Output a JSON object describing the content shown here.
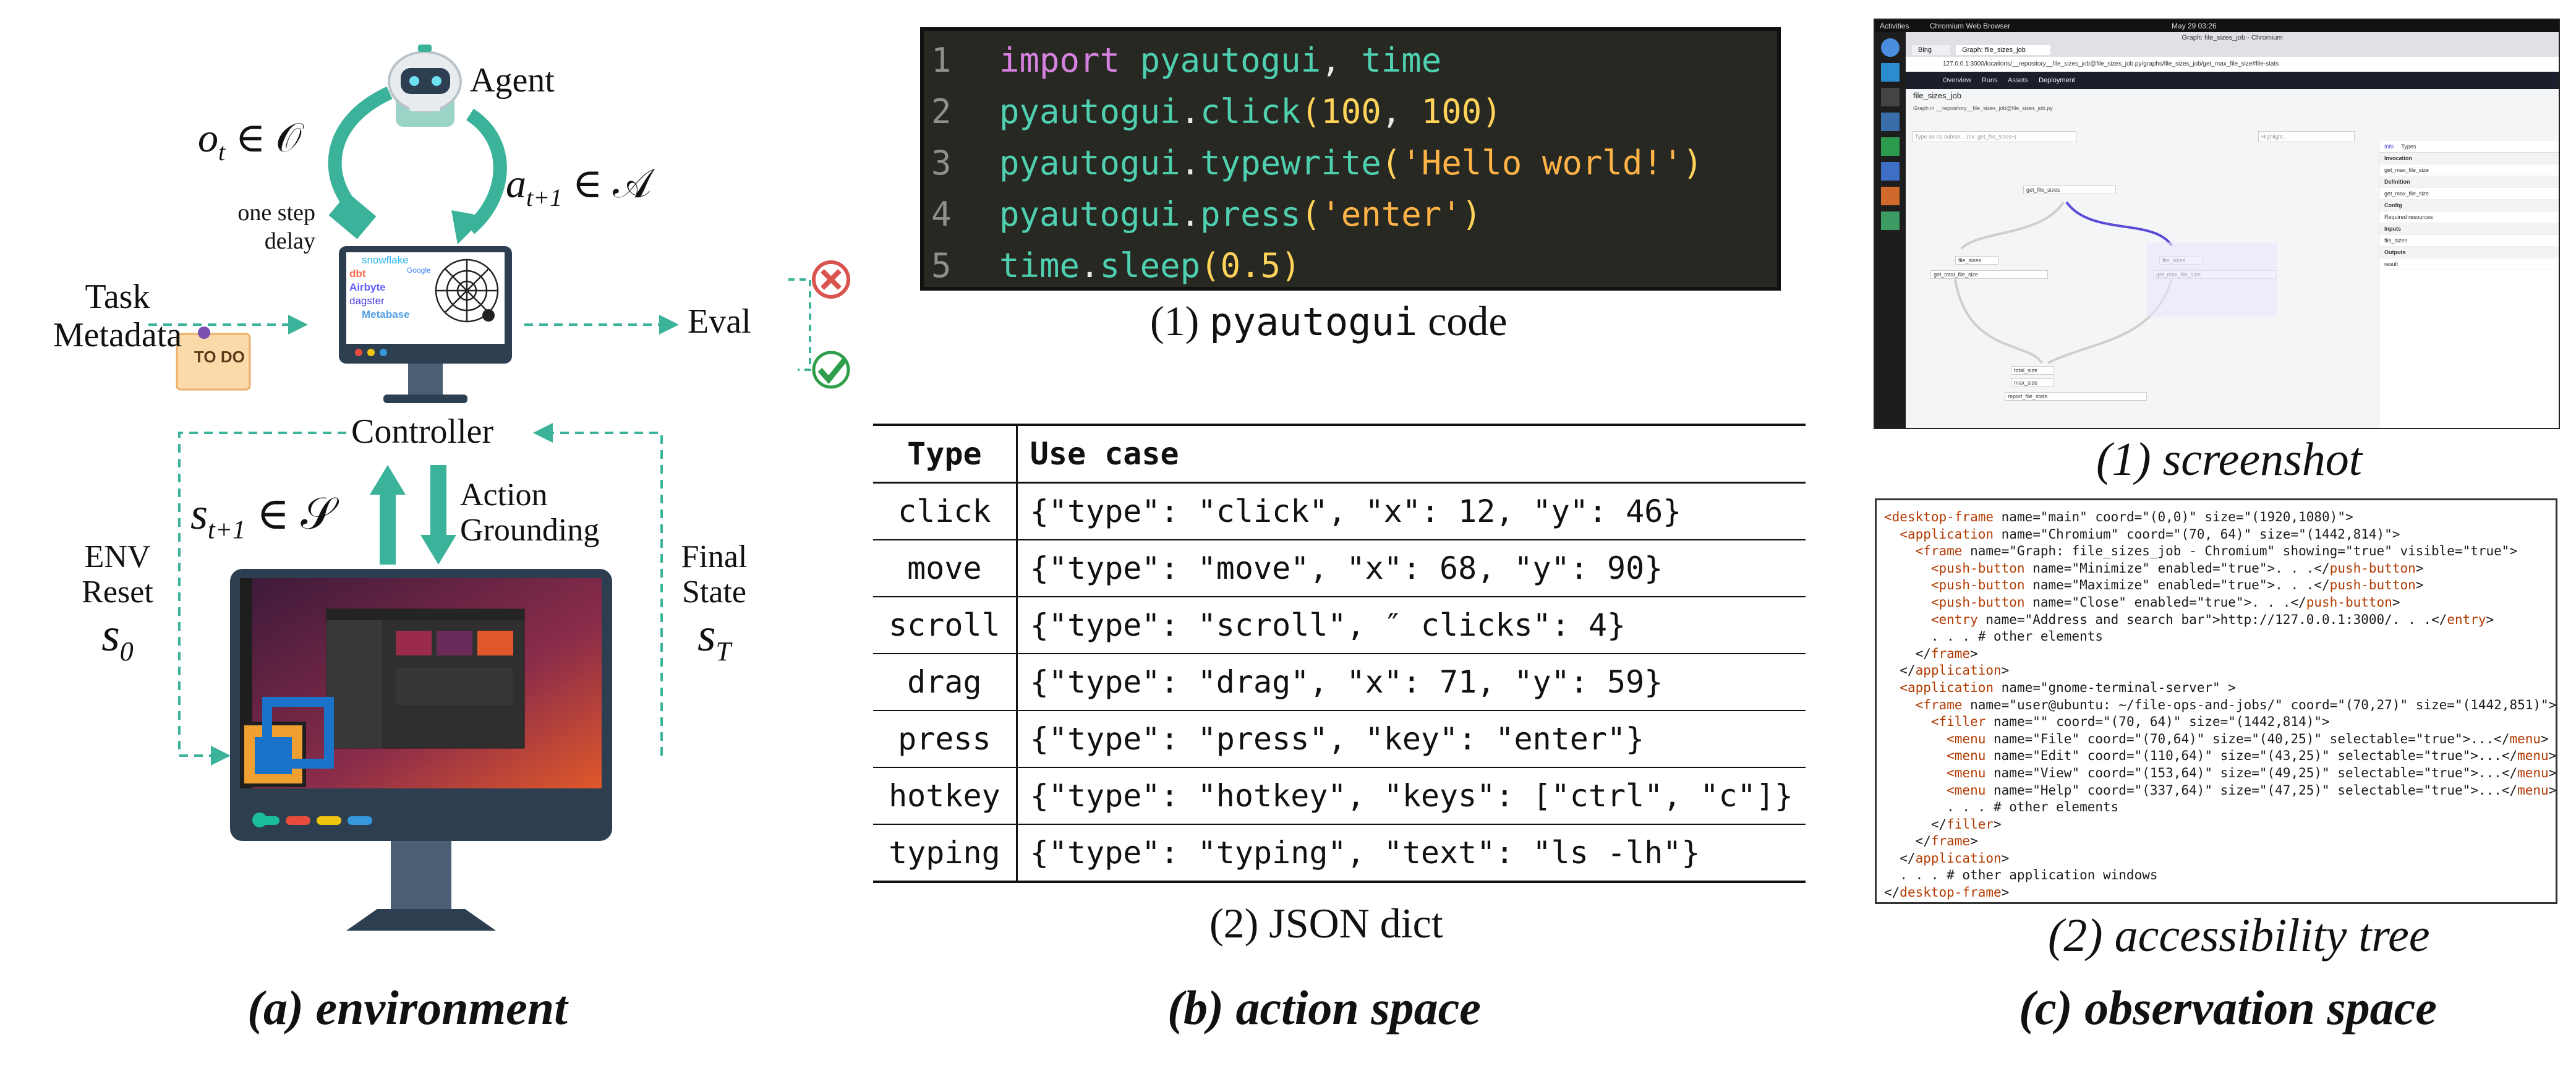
{
  "colors": {
    "teal": "#3bb39a",
    "code_bg": "#272822",
    "accent_red": "#d9534f",
    "accent_green": "#2e9e4a",
    "monitor_dark": "#2c3e50"
  },
  "panel_a": {
    "caption": "(a) environment",
    "agent_label": "Agent",
    "obs_label": "o",
    "obs_sub": "t",
    "obs_set": " ∈ 𝒪",
    "act_label": "a",
    "act_sub": "t+1",
    "act_set": " ∈ 𝒜",
    "delay_label_1": "one step",
    "delay_label_2": "delay",
    "task_label_1": "Task",
    "task_label_2": "Metadata",
    "todo_label": "TO DO",
    "eval_label": "Eval",
    "controller_label": "Controller",
    "state_label": "s",
    "state_sub": "t+1",
    "state_set": " ∈ 𝒮",
    "action_label": "Action",
    "grounding_label": "Grounding",
    "env_label": "ENV",
    "reset_label": "Reset",
    "s0_label": "s",
    "s0_sub": "0",
    "final_label": "Final",
    "fstate_label": "State",
    "sT_label": "s",
    "sT_sub": "T",
    "logos": [
      "dbt",
      "Airbyte",
      "dagster",
      "Metabase",
      "snowflake",
      "Google"
    ],
    "icons": [
      "robot-icon",
      "spider-icon",
      "vscode-icon",
      "check-icon",
      "cross-icon",
      "todo-note-icon"
    ]
  },
  "panel_b": {
    "caption": "(b) action space",
    "code_caption_prefix": "(1) ",
    "code_caption_mono": "pyautogui",
    "code_caption_suffix": " code",
    "code_lines": [
      {
        "n": "1",
        "tokens": [
          [
            "kw",
            "import "
          ],
          [
            "nm",
            "pyautogui"
          ],
          [
            "pn",
            ", "
          ],
          [
            "nm",
            "time"
          ]
        ]
      },
      {
        "n": "2",
        "tokens": [
          [
            "nm",
            "pyautogui"
          ],
          [
            "pn",
            "."
          ],
          [
            "fn",
            "click"
          ],
          [
            "num",
            "("
          ],
          [
            "num",
            "100"
          ],
          [
            "pn",
            ", "
          ],
          [
            "num",
            "100"
          ],
          [
            "num",
            ")"
          ]
        ]
      },
      {
        "n": "3",
        "tokens": [
          [
            "nm",
            "pyautogui"
          ],
          [
            "pn",
            "."
          ],
          [
            "fn",
            "typewrite"
          ],
          [
            "num",
            "("
          ],
          [
            "str",
            "'Hello world!'"
          ],
          [
            "num",
            ")"
          ]
        ]
      },
      {
        "n": "4",
        "tokens": [
          [
            "nm",
            "pyautogui"
          ],
          [
            "pn",
            "."
          ],
          [
            "fn",
            "press"
          ],
          [
            "num",
            "("
          ],
          [
            "str",
            "'enter'"
          ],
          [
            "num",
            ")"
          ]
        ]
      },
      {
        "n": "5",
        "tokens": [
          [
            "nm",
            "time"
          ],
          [
            "pn",
            "."
          ],
          [
            "fn",
            "sleep"
          ],
          [
            "num",
            "("
          ],
          [
            "num",
            "0.5"
          ],
          [
            "num",
            ")"
          ]
        ]
      }
    ],
    "table_caption": "(2) JSON dict",
    "table_headers": [
      "Type",
      "Use case"
    ],
    "table_rows": [
      [
        "click",
        "{\"type\": \"click\", \"x\": 12, \"y\": 46}"
      ],
      [
        "move",
        "{\"type\": \"move\", \"x\": 68, \"y\": 90}"
      ],
      [
        "scroll",
        "{\"type\": \"scroll\", ″ clicks\": 4}"
      ],
      [
        "drag",
        "{\"type\": \"drag\", \"x\": 71, \"y\": 59}"
      ],
      [
        "press",
        "{\"type\": \"press\", \"key\": \"enter\"}"
      ],
      [
        "hotkey",
        "{\"type\": \"hotkey\", \"keys\": [\"ctrl\", \"c\"]}"
      ],
      [
        "typing",
        "{\"type\": \"typing\", \"text\": \"ls -lh\"}"
      ]
    ]
  },
  "panel_c": {
    "caption": "(c) observation space",
    "screenshot_caption": "(1) screenshot",
    "tree_caption": "(2) accessibility tree",
    "screenshot": {
      "window_title": "Graph: file_sizes_job - Chromium",
      "top_left": "Activities",
      "top_app": "Chromium Web Browser",
      "top_time": "May 29  03:26",
      "tab1": "Bing",
      "tab2": "Graph: file_sizes_job",
      "url": "127.0.0.1:3000/locations/__repository__file_sizes_job@file_sizes_job.py/graphs/file_sizes_job/get_max_file_size#file-stats",
      "nav": [
        "Overview",
        "Runs",
        "Assets",
        "Deployment"
      ],
      "job_name": "file_sizes_job",
      "crumb": "Graph in __repository__file_sizes_job@file_sizes_job.py",
      "search_ph": "Type an op subset... (ex. get_file_sizes+)",
      "highlight_ph": "Highlight...",
      "nodes": [
        "get_file_sizes",
        "file_sizes",
        "get_total_file_size",
        "file_sizes",
        "get_max_file_size",
        "total_size",
        "max_size",
        "report_file_stats"
      ],
      "side_tabs": [
        "Info",
        "Types"
      ],
      "side_sections": [
        "Invocation",
        "get_max_file_size",
        "Definition",
        "get_max_file_size",
        "Config",
        "Required resources",
        "Inputs",
        "file_sizes",
        "Outputs",
        "result"
      ]
    },
    "tree_lines": [
      [
        [
          "tg",
          "<desktop-frame"
        ],
        [
          "at",
          " name=\"main\" coord=\"(0,0)\" size=\"(1920,1080)\">"
        ]
      ],
      [
        [
          "at",
          "  "
        ],
        [
          "tg",
          "<application"
        ],
        [
          "at",
          " name=\"Chromium\" coord=\"(70, 64)\" size=\"(1442,814)\">"
        ]
      ],
      [
        [
          "at",
          "    "
        ],
        [
          "tg",
          "<frame"
        ],
        [
          "at",
          " name=\"Graph: file_sizes_job - Chromium\" showing=\"true\" visible=\"true\">"
        ]
      ],
      [
        [
          "at",
          "      "
        ],
        [
          "tg",
          "<push-button"
        ],
        [
          "at",
          " name=\"Minimize\" enabled=\"true\">. . .</"
        ],
        [
          "tg",
          "push-button"
        ],
        [
          "at",
          ">"
        ]
      ],
      [
        [
          "at",
          "      "
        ],
        [
          "tg",
          "<push-button"
        ],
        [
          "at",
          " name=\"Maximize\" enabled=\"true\">. . .</"
        ],
        [
          "tg",
          "push-button"
        ],
        [
          "at",
          ">"
        ]
      ],
      [
        [
          "at",
          "      "
        ],
        [
          "tg",
          "<push-button"
        ],
        [
          "at",
          " name=\"Close\" enabled=\"true\">. . .</"
        ],
        [
          "tg",
          "push-button"
        ],
        [
          "at",
          ">"
        ]
      ],
      [
        [
          "at",
          "      "
        ],
        [
          "tg",
          "<entry"
        ],
        [
          "at",
          " name=\"Address and search bar\">http://127.0.0.1:3000/. . .</"
        ],
        [
          "tg",
          "entry"
        ],
        [
          "at",
          ">"
        ]
      ],
      [
        [
          "at",
          "      . . . # other elements"
        ]
      ],
      [
        [
          "at",
          "    </"
        ],
        [
          "tg",
          "frame"
        ],
        [
          "at",
          ">"
        ]
      ],
      [
        [
          "at",
          "  </"
        ],
        [
          "tg",
          "application"
        ],
        [
          "at",
          ">"
        ]
      ],
      [
        [
          "at",
          "  "
        ],
        [
          "tg",
          "<application"
        ],
        [
          "at",
          " name=\"gnome-terminal-server\" >"
        ]
      ],
      [
        [
          "at",
          "    "
        ],
        [
          "tg",
          "<frame"
        ],
        [
          "at",
          " name=\"user@ubuntu: ~/file-ops-and-jobs/\" coord=\"(70,27)\" size=\"(1442,851)\">"
        ]
      ],
      [
        [
          "at",
          "      "
        ],
        [
          "tg",
          "<filler"
        ],
        [
          "at",
          " name=\"\" coord=\"(70, 64)\" size=\"(1442,814)\">"
        ]
      ],
      [
        [
          "at",
          "        "
        ],
        [
          "tg",
          "<menu"
        ],
        [
          "at",
          " name=\"File\" coord=\"(70,64)\" size=\"(40,25)\" selectable=\"true\">...</"
        ],
        [
          "tg",
          "menu"
        ],
        [
          "at",
          ">"
        ]
      ],
      [
        [
          "at",
          "        "
        ],
        [
          "tg",
          "<menu"
        ],
        [
          "at",
          " name=\"Edit\" coord=\"(110,64)\" size=\"(43,25)\" selectable=\"true\">...</"
        ],
        [
          "tg",
          "menu"
        ],
        [
          "at",
          ">"
        ]
      ],
      [
        [
          "at",
          "        "
        ],
        [
          "tg",
          "<menu"
        ],
        [
          "at",
          " name=\"View\" coord=\"(153,64)\" size=\"(49,25)\" selectable=\"true\">...</"
        ],
        [
          "tg",
          "menu"
        ],
        [
          "at",
          ">"
        ]
      ],
      [
        [
          "at",
          "        "
        ],
        [
          "tg",
          "<menu"
        ],
        [
          "at",
          " name=\"Help\" coord=\"(337,64)\" size=\"(47,25)\" selectable=\"true\">...</"
        ],
        [
          "tg",
          "menu"
        ],
        [
          "at",
          ">"
        ]
      ],
      [
        [
          "at",
          "        . . . # other elements"
        ]
      ],
      [
        [
          "at",
          "      </"
        ],
        [
          "tg",
          "filler"
        ],
        [
          "at",
          ">"
        ]
      ],
      [
        [
          "at",
          "    </"
        ],
        [
          "tg",
          "frame"
        ],
        [
          "at",
          ">"
        ]
      ],
      [
        [
          "at",
          "  </"
        ],
        [
          "tg",
          "application"
        ],
        [
          "at",
          ">"
        ]
      ],
      [
        [
          "at",
          "  . . . # other application windows"
        ]
      ],
      [
        [
          "at",
          "</"
        ],
        [
          "tg",
          "desktop-frame"
        ],
        [
          "at",
          ">"
        ]
      ]
    ]
  }
}
